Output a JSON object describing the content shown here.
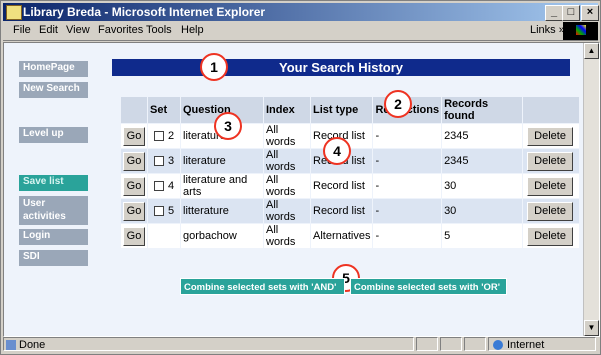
{
  "window": {
    "title": "Library Breda - Microsoft Internet Explorer",
    "min": "_",
    "max": "□",
    "close": "×"
  },
  "menu": [
    "File",
    "Edit",
    "View",
    "Favorites",
    "Tools",
    "Help"
  ],
  "links": "Links »",
  "sidebar": {
    "items": [
      {
        "label": "HomePage"
      },
      {
        "label": "New Search"
      },
      {
        "label": "Level up"
      },
      {
        "label": "Save list"
      },
      {
        "label": "User activities"
      },
      {
        "label": "Login"
      },
      {
        "label": "SDI"
      }
    ]
  },
  "header": {
    "title": "Your Search History"
  },
  "table": {
    "headers": [
      "",
      "Set",
      "Question",
      "Index",
      "List type",
      "Restrictions",
      "Records found",
      ""
    ],
    "rows": [
      {
        "go": "Go",
        "set": "2",
        "question": "literature",
        "index": "All words",
        "list_type": "Record list",
        "restrictions": "-",
        "records": "2345",
        "delete": "Delete"
      },
      {
        "go": "Go",
        "set": "3",
        "question": "literature",
        "index": "All words",
        "list_type": "Record list",
        "restrictions": "-",
        "records": "2345",
        "delete": "Delete"
      },
      {
        "go": "Go",
        "set": "4",
        "question": "literature and arts",
        "index": "All words",
        "list_type": "Record list",
        "restrictions": "-",
        "records": "30",
        "delete": "Delete"
      },
      {
        "go": "Go",
        "set": "5",
        "question": "litterature",
        "index": "All words",
        "list_type": "Record list",
        "restrictions": "-",
        "records": "30",
        "delete": "Delete"
      },
      {
        "go": "Go",
        "set": "",
        "question": "gorbachow",
        "index": "All words",
        "list_type": "Alternatives",
        "restrictions": "-",
        "records": "5",
        "delete": "Delete"
      }
    ]
  },
  "callouts": [
    "1",
    "2",
    "3",
    "4",
    "5"
  ],
  "combine": {
    "and_label": "Combine selected sets with 'AND'",
    "or_label": "Combine selected sets with 'OR'"
  },
  "status": {
    "text": "Done",
    "zone": "Internet"
  },
  "colors": {
    "header_bar": "#0f2a8c",
    "nav_button": "#9aa7b8",
    "nav_active": "#2aa39a",
    "callout_border": "#e32"
  }
}
